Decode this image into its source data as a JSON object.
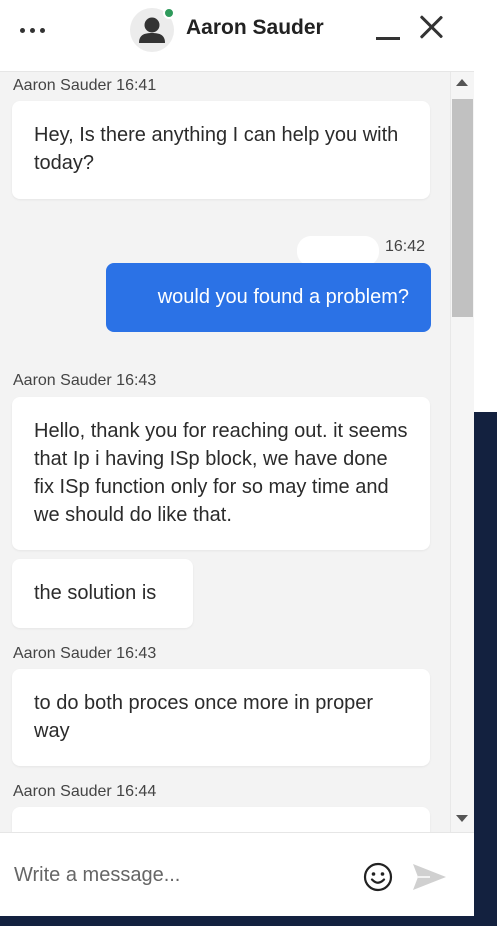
{
  "header": {
    "title": "Aaron Sauder",
    "more_icon": "more-horizontal-icon",
    "minimize_icon": "minimize-icon",
    "close_icon": "close-icon"
  },
  "messages": [
    {
      "meta": "Aaron Sauder 16:41",
      "text": "Hey, Is there anything I can help you with today?"
    },
    {
      "meta": "16:42",
      "text": "would you found a problem?",
      "from_user": true
    },
    {
      "meta": "Aaron Sauder 16:43",
      "text": "Hello, thank you for reaching out. it seems that Ip i having ISp block, we have done fix ISp function only for so may time and we should do like that."
    },
    {
      "text": "the solution is"
    },
    {
      "meta": "Aaron Sauder 16:43",
      "text": "to do both proces once more in proper way"
    },
    {
      "meta": "Aaron Sauder 16:44",
      "text": ""
    }
  ],
  "composer": {
    "placeholder": "Write a message...",
    "emoji_icon": "emoji-smile-icon",
    "send_icon": "send-icon"
  },
  "colors": {
    "accent": "#2b72e6",
    "online": "#2e9a5b",
    "background_dark": "#13213f",
    "chat_bg": "#f3f3f3"
  }
}
